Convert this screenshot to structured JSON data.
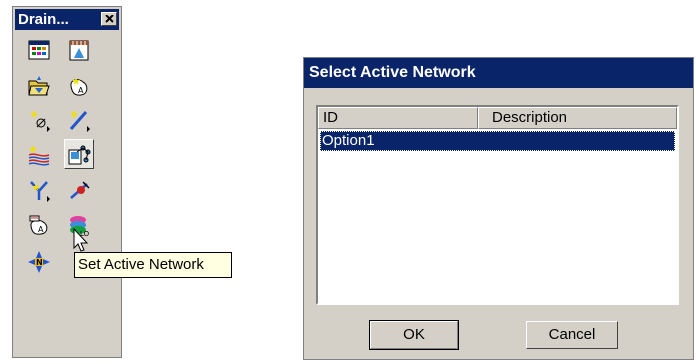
{
  "palette": {
    "title": "Drain...",
    "close_icon": "close-icon",
    "tools": [
      {
        "icon": "grid-table-icon"
      },
      {
        "icon": "film-frame-icon"
      },
      {
        "icon": "open-folder-icon"
      },
      {
        "icon": "area-pin-icon"
      },
      {
        "icon": "node-star-icon"
      },
      {
        "icon": "draw-line-icon"
      },
      {
        "icon": "flow-lines-icon"
      },
      {
        "icon": "set-active-network-icon"
      },
      {
        "icon": "branch-arrows-icon"
      },
      {
        "icon": "connector-icon"
      },
      {
        "icon": "area-edit-icon"
      },
      {
        "icon": "layers-color-icon"
      },
      {
        "icon": "north-arrow-icon"
      }
    ]
  },
  "tooltip": {
    "text": "Set Active Network"
  },
  "dialog": {
    "title": "Select Active Network",
    "columns": {
      "id": "ID",
      "description": "Description"
    },
    "rows": [
      {
        "id": "Option1",
        "description": ""
      }
    ],
    "ok_label": "OK",
    "cancel_label": "Cancel"
  },
  "colors": {
    "title_bar": "#0a246a",
    "face": "#d4d0c8",
    "tooltip_bg": "#ffffe1",
    "selection": "#0a246a"
  }
}
